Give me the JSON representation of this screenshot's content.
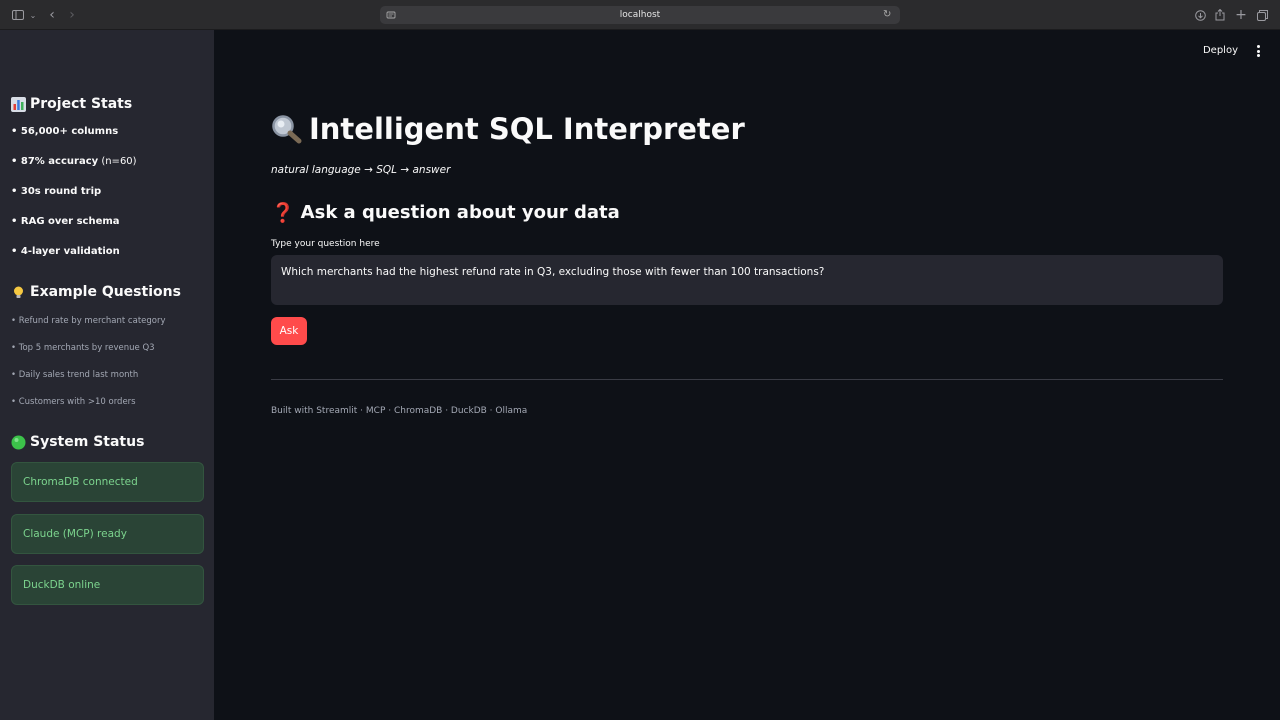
{
  "browser": {
    "url": "localhost",
    "icons": [
      "sidebar-toggle-icon",
      "chevron-down-icon",
      "back-icon",
      "forward-icon",
      "download-icon",
      "share-icon",
      "new-tab-icon",
      "tabs-overview-icon"
    ]
  },
  "header": {
    "deploy_label": "Deploy"
  },
  "sidebar": {
    "project_stats": {
      "title": "Project Stats",
      "items": [
        {
          "text": "• 56,000+ columns",
          "extra": ""
        },
        {
          "text": "• 87% accuracy",
          "extra": " (n=60)"
        },
        {
          "text": "• 30s round trip",
          "extra": ""
        },
        {
          "text": "• RAG over schema",
          "extra": ""
        },
        {
          "text": "• 4-layer validation",
          "extra": ""
        }
      ]
    },
    "example_questions": {
      "title": "Example Questions",
      "items": [
        "• Refund rate by merchant category",
        "• Top 5 merchants by revenue Q3",
        "• Daily sales trend last month",
        "• Customers with >10 orders"
      ]
    },
    "system_status": {
      "title": "System Status",
      "items": [
        "ChromaDB connected",
        "Claude (MCP) ready",
        "DuckDB online"
      ]
    }
  },
  "main": {
    "title": "Intelligent SQL Interpreter",
    "subtitle": "natural language → SQL → answer",
    "section_title": "Ask a question about your data",
    "input_label": "Type your question here",
    "question_value": "Which merchants had the highest refund rate in Q3, excluding those with fewer than 100 transactions?",
    "ask_label": "Ask",
    "footer": "Built with Streamlit · MCP · ChromaDB · DuckDB · Ollama"
  },
  "colors": {
    "background": "#0e1117",
    "sidebar": "#262730",
    "accent": "#ff4b4b",
    "status_bg": "#2a4436",
    "status_text": "#7cd48e"
  }
}
